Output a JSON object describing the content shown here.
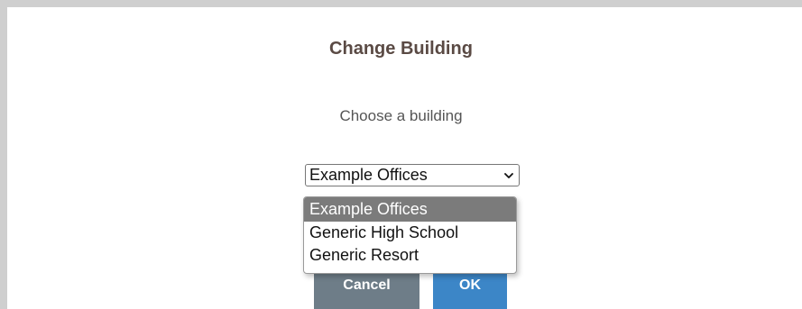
{
  "dialog": {
    "title": "Change Building",
    "prompt": "Choose a building"
  },
  "building_select": {
    "selected_value": "Example Offices",
    "options": [
      {
        "label": "Example Offices",
        "selected": true
      },
      {
        "label": "Generic High School",
        "selected": false
      },
      {
        "label": "Generic Resort",
        "selected": false
      }
    ]
  },
  "buttons": {
    "cancel_label": "Cancel",
    "ok_label": "OK"
  },
  "icons": {
    "dropdown_arrow": "chevron-down-icon"
  },
  "colors": {
    "title_text": "#5a4a44",
    "cancel_button": "#6e7d88",
    "ok_button": "#3c86c7",
    "selected_option": "#7b7b7b"
  }
}
